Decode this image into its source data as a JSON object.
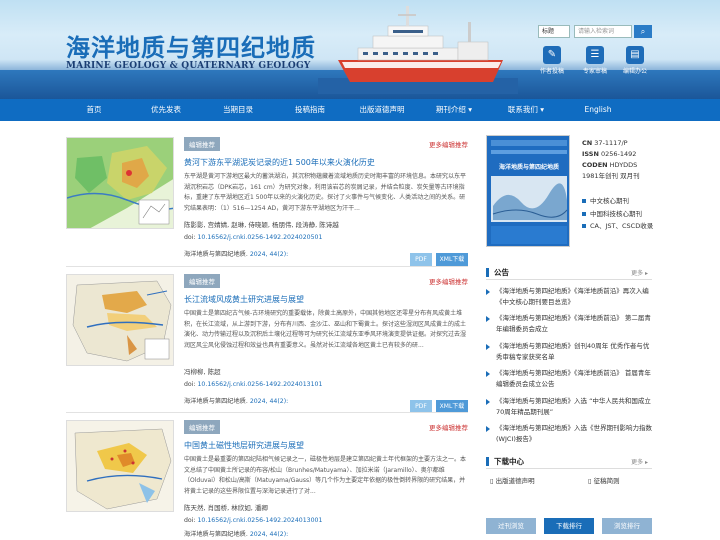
{
  "header": {
    "logo_cn": "海洋地质与第四纪地质",
    "logo_en": "MARINE GEOLOGY & QUATERNARY GEOLOGY",
    "search_select": "标题",
    "search_placeholder": "请输入检索词",
    "quick_links": [
      {
        "label": "作者投稿",
        "icon": "author-icon"
      },
      {
        "label": "专家审稿",
        "icon": "reviewer-icon"
      },
      {
        "label": "编辑办公",
        "icon": "editor-icon"
      }
    ]
  },
  "nav": [
    "首页",
    "优先发表",
    "当期目录",
    "投稿指南",
    "出版道德声明",
    "期刊介绍 ▾",
    "联系我们 ▾",
    "English"
  ],
  "articles": [
    {
      "badge": "编辑推荐",
      "more": "更多编辑推荐",
      "title": "黄河下游东平湖泥炭记录的近1 500年以来火演化历史",
      "abstract": "东平湖是黄河下游地区最大的蓄洪湖泊，其沉积物蕴藏着流域地质历史时期丰富的环境信息。本研究以东平湖沉积岩芯（DPK岩芯，161 cm）为研究对象，利用该岩芯的炭屑记录，并结合粒度、炭矢量等古环境指标，重建了东平湖地区近1 500年以来的火演化历史。探讨了火事件与气候变化、人类活动之间的关系。研究结果表明：（1）516—1254 AD，黄河下游东平湖地区为汗干...",
      "authors": "陈影影, 宫婧婧, 赵琳, 侍晓颖, 杨朋伟, 段涛静, 陈诗越",
      "doi_label": "doi: ",
      "doi": "10.16562/j.cnki.0256-1492.2024020501",
      "journal": "海洋地质与第四纪地质. ",
      "volume": "2024, 44(2):",
      "pdf": "PDF",
      "xml": "XML下载"
    },
    {
      "badge": "编辑推荐",
      "more": "更多编辑推荐",
      "title": "长江流域风成黄土研究进展与展望",
      "abstract": "中国黄土是第四纪古气候-古环境研究的重要载体，除黄土高原外，中国其他地区还零星分布有风成黄土堆积，在长江流域，从上游到下游，分布有川西、金沙江、巫山和下蜀黄土。探讨这些湿润区风成黄土的成土演化、动力传输过程以及沉积后土壤化过程等可为研究长江流域东亚季风环境演变提供证据。对探究过去湿润区风尘风化侵蚀过程和效益也具有重要意义。虽然对长江流域各地区黄土已有较多的研...",
      "authors": "冯柳柳, 陈超",
      "doi_label": "doi: ",
      "doi": "10.16562/j.cnki.0256-1492.2024013101",
      "journal": "海洋地质与第四纪地质. ",
      "volume": "2024, 44(2):",
      "pdf": "PDF",
      "xml": "XML下载"
    },
    {
      "badge": "编辑推荐",
      "more": "更多编辑推荐",
      "title": "中国黄土磁性地层研究进展与展望",
      "abstract": "中国黄土是最重要的第四纪陆相气候记录之一，磁极性地层是建立第四纪黄土年代框架的主要方法之一。本文总结了中国黄土所记录的布容/松山（Brunhes/Matuyama）、加拉米诺（Jaramillo）、奥尔都维（Olduvai）和松山/高斯（Matuyama/Gauss）等几个作为主要定年依据的极性倒转界限的研究结果，并将黄土记录的这些界限位置与深海记录进行了对...",
      "authors": "陈天然, 肖国桥, 林欣如, 潘卿",
      "doi_label": "doi: ",
      "doi": "10.16562/j.cnki.0256-1492.2024013001",
      "journal": "海洋地质与第四纪地质. ",
      "volume": "2024, 44(2):",
      "pdf": "PDF",
      "xml": "XML下载"
    }
  ],
  "cover_title": "海洋地质与第四纪地质",
  "journal_info": {
    "cn_label": "CN",
    "cn": "37-1117/P",
    "issn_label": "ISSN",
    "issn": "0256-1492",
    "coden_label": "CODEN",
    "coden": "HDYDDS",
    "since": "1981年创刊  双月刊"
  },
  "indexes": [
    "中文核心期刊",
    "中国科技核心期刊",
    "CA、JST、CSCD收录"
  ],
  "notices": {
    "heading": "公告",
    "more": "更多 ▸",
    "items": [
      "《海洋地质与第四纪地质》《海洋地质前沿》再次入编《中文核心期刊要目总览》",
      "《海洋地质与第四纪地质》《海洋地质前沿》 第二届青年编辑委员会成立",
      "《海洋地质与第四纪地质》创刊40周年 优秀作者与优秀审稿专家获奖名单",
      "《海洋地质与第四纪地质》《海洋地质前沿》 首届青年编辑委员会成立公告",
      "《海洋地质与第四纪地质》入选 “中华人民共和国成立70周年精品期刊展”",
      "《海洋地质与第四纪地质》入选《世界期刊影响力指数(WJCI)报告》"
    ]
  },
  "downloads": {
    "heading": "下载中心",
    "more": "更多 ▸",
    "items": [
      "出版道德声明",
      "征稿简则"
    ]
  },
  "bottom_tabs": [
    "过刊浏览",
    "下载排行",
    "浏览排行"
  ],
  "colors": {
    "nav": "#0f6cc2",
    "link": "#1a6db8",
    "badge": "#8ea7bd",
    "more": "#cc3333"
  }
}
